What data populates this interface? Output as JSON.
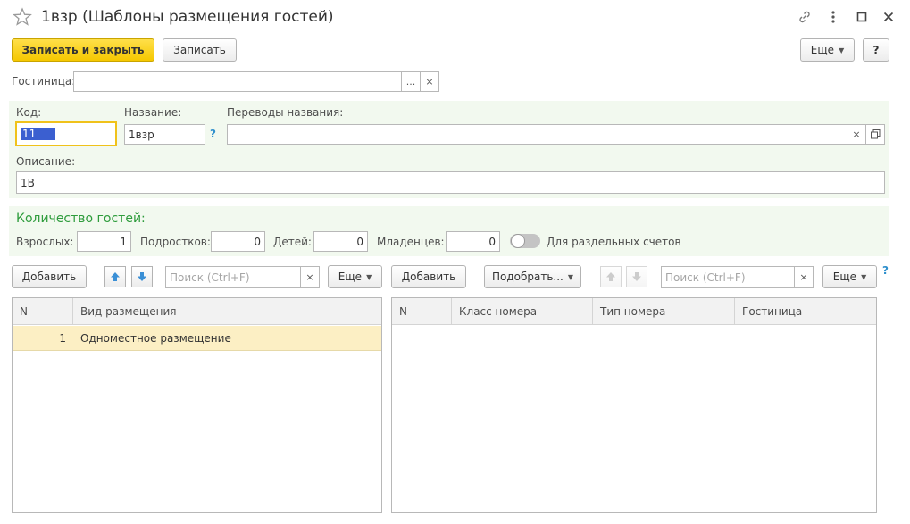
{
  "window": {
    "title": "1взр (Шаблоны размещения гостей)"
  },
  "toolbar": {
    "save_close": "Записать и закрыть",
    "save": "Записать",
    "more": "Еще",
    "help": "?"
  },
  "hotel": {
    "label": "Гостиница:",
    "value": "",
    "select_btn": "...",
    "clear_btn": "×"
  },
  "fields": {
    "code_label": "Код:",
    "code_value": "11",
    "name_label": "Название:",
    "name_value": "1взр",
    "name_help": "?",
    "translations_label": "Переводы названия:",
    "translations_value": "",
    "description_label": "Описание:",
    "description_value": "1В"
  },
  "guests": {
    "title": "Количество гостей:",
    "adults_label": "Взрослых:",
    "adults_value": "1",
    "teens_label": "Подростков:",
    "teens_value": "0",
    "children_label": "Детей:",
    "children_value": "0",
    "infants_label": "Младенцев:",
    "infants_value": "0",
    "separate_label": "Для раздельных счетов"
  },
  "left_panel": {
    "add": "Добавить",
    "search_placeholder": "Поиск (Ctrl+F)",
    "clear": "×",
    "more": "Еще",
    "columns": [
      "N",
      "Вид размещения"
    ],
    "rows": [
      {
        "n": "1",
        "type": "Одноместное размещение"
      }
    ]
  },
  "right_panel": {
    "add": "Добавить",
    "pick": "Подобрать...",
    "search_placeholder": "Поиск (Ctrl+F)",
    "clear": "×",
    "more": "Еще",
    "help": "?",
    "columns": [
      "N",
      "Класс номера",
      "Тип номера",
      "Гостиница"
    ]
  },
  "colors": {
    "primary": "#f5c800",
    "accent_green": "#2e9c3c",
    "panel_bg": "#f2f9ef",
    "selected_row": "#fcefc4",
    "help_blue": "#2e8fcc"
  }
}
